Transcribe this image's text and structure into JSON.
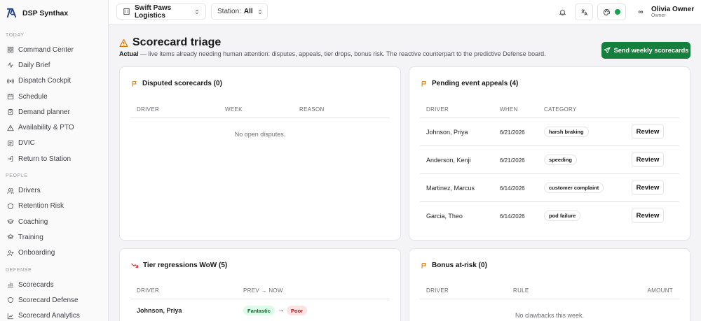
{
  "app": {
    "name": "DSP Synthax"
  },
  "sidebar": {
    "sections": [
      {
        "label": "TODAY",
        "items": [
          {
            "label": "Command Center",
            "icon": "grid-icon"
          },
          {
            "label": "Daily Brief",
            "icon": "pulse-icon"
          },
          {
            "label": "Dispatch Cockpit",
            "icon": "radio-icon"
          },
          {
            "label": "Schedule",
            "icon": "calendar-icon"
          },
          {
            "label": "Demand planner",
            "icon": "clipboard-check-icon"
          },
          {
            "label": "Availability & PTO",
            "icon": "alert-triangle-icon"
          },
          {
            "label": "DVIC",
            "icon": "checklist-icon"
          },
          {
            "label": "Return to Station",
            "icon": "log-in-icon"
          }
        ]
      },
      {
        "label": "PEOPLE",
        "items": [
          {
            "label": "Drivers",
            "icon": "users-icon"
          },
          {
            "label": "Retention Risk",
            "icon": "shield-icon"
          },
          {
            "label": "Coaching",
            "icon": "graduation-cap-icon"
          },
          {
            "label": "Training",
            "icon": "graduation-cap-icon"
          },
          {
            "label": "Onboarding",
            "icon": "user-plus-icon"
          }
        ]
      },
      {
        "label": "DEFENSE",
        "items": [
          {
            "label": "Scorecards",
            "icon": "bar-chart-icon"
          },
          {
            "label": "Scorecard Defense",
            "icon": "shield-icon"
          },
          {
            "label": "Scorecard Analytics",
            "icon": "line-chart-icon"
          }
        ]
      }
    ]
  },
  "topbar": {
    "org": "Swift Paws Logistics",
    "station_label": "Station:",
    "station_value": "All",
    "user": {
      "name": "Olivia Owner",
      "role": "Owner"
    },
    "status_color": "#16a34a"
  },
  "page": {
    "title": "Scorecard triage",
    "subtitle_strong": "Actual",
    "subtitle_rest": " — live items already needing human attention: disputes, appeals, tier drops, bonus risk. The reactive counterpart to the predictive Defense board.",
    "send_button": "Send weekly scorecards"
  },
  "disputed": {
    "title": "Disputed scorecards (0)",
    "columns": [
      "DRIVER",
      "WEEK",
      "REASON"
    ],
    "empty": "No open disputes."
  },
  "appeals": {
    "title": "Pending event appeals (4)",
    "columns": [
      "DRIVER",
      "WHEN",
      "CATEGORY"
    ],
    "action_label": "Review",
    "rows": [
      {
        "driver": "Johnson, Priya",
        "when": "6/21/2026",
        "category": "harsh braking"
      },
      {
        "driver": "Anderson, Kenji",
        "when": "6/21/2026",
        "category": "speeding"
      },
      {
        "driver": "Martinez, Marcus",
        "when": "6/14/2026",
        "category": "customer complaint"
      },
      {
        "driver": "Garcia, Theo",
        "when": "6/14/2026",
        "category": "pod failure"
      }
    ]
  },
  "regressions": {
    "title": "Tier regressions WoW (5)",
    "columns": [
      "DRIVER",
      "PREV → NOW"
    ],
    "rows": [
      {
        "driver": "Johnson, Priya",
        "prev": "Fantastic",
        "now": "Poor"
      }
    ]
  },
  "bonus": {
    "title": "Bonus at-risk (0)",
    "columns": [
      "DRIVER",
      "RULE",
      "AMOUNT"
    ],
    "empty": "No clawbacks this week."
  },
  "colors": {
    "accent_green": "#15803d",
    "warning": "#d97706",
    "danger": "#dc2626",
    "tier_good_bg": "#dcfce7",
    "tier_bad_bg": "#fee2e2"
  }
}
